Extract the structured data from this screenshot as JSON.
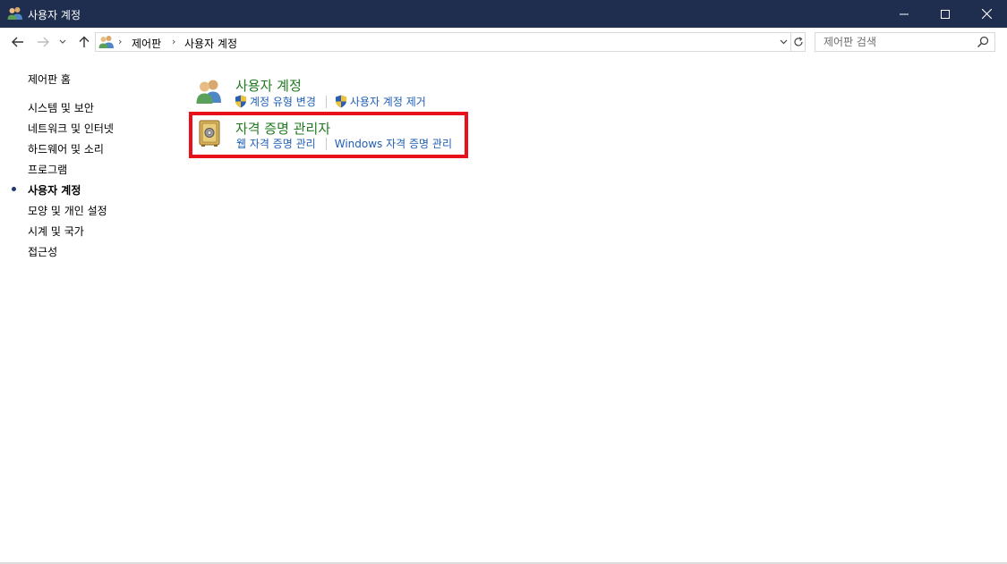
{
  "window": {
    "title": "사용자 계정",
    "controls": {
      "minimize": "minimize",
      "maximize": "maximize",
      "close": "close"
    }
  },
  "address": {
    "crumbs": [
      "제어판",
      "사용자 계정"
    ]
  },
  "search": {
    "placeholder": "제어판 검색"
  },
  "sidebar": {
    "home": "제어판 홈",
    "items": [
      {
        "label": "시스템 및 보안",
        "active": false
      },
      {
        "label": "네트워크 및 인터넷",
        "active": false
      },
      {
        "label": "하드웨어 및 소리",
        "active": false
      },
      {
        "label": "프로그램",
        "active": false
      },
      {
        "label": "사용자 계정",
        "active": true
      },
      {
        "label": "모양 및 개인 설정",
        "active": false
      },
      {
        "label": "시계 및 국가",
        "active": false
      },
      {
        "label": "접근성",
        "active": false
      }
    ]
  },
  "main": {
    "categories": [
      {
        "title": "사용자 계정",
        "icon": "users-icon",
        "links": [
          {
            "label": "계정 유형 변경",
            "icon": "shield-icon"
          },
          {
            "label": "사용자 계정 제거",
            "icon": "shield-icon"
          }
        ]
      },
      {
        "title": "자격 증명 관리자",
        "icon": "vault-icon",
        "highlighted": true,
        "links": [
          {
            "label": "웹 자격 증명 관리"
          },
          {
            "label": "Windows 자격 증명 관리"
          }
        ]
      }
    ]
  },
  "colors": {
    "titlebar": "#1f2d4f",
    "category_title": "#1e7a1e",
    "link": "#1f5fb4",
    "highlight": "#e8101a"
  }
}
